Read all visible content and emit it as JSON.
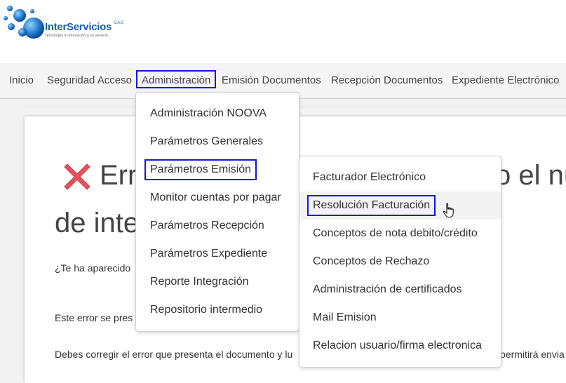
{
  "logo": {
    "name": "InterServicios",
    "suffix": "S.A.S",
    "tagline": "Tecnología e innovación a su servicio"
  },
  "nav": {
    "items": [
      {
        "label": "Inicio"
      },
      {
        "label": "Seguridad Acceso"
      },
      {
        "label": "Administración"
      },
      {
        "label": "Emisión Documentos"
      },
      {
        "label": "Recepción Documentos"
      },
      {
        "label": "Expediente Electrónico"
      }
    ],
    "active": "Administración"
  },
  "admin_menu": {
    "items": [
      {
        "label": "Administración NOOVA"
      },
      {
        "label": "Parámetros Generales"
      },
      {
        "label": "Parámetros Emisión"
      },
      {
        "label": "Monitor cuentas por pagar"
      },
      {
        "label": "Parámetros Recepción"
      },
      {
        "label": "Parámetros Expediente"
      },
      {
        "label": "Reporte Integración"
      },
      {
        "label": "Repositorio intermedio"
      }
    ],
    "highlighted": "Parámetros Emisión"
  },
  "emision_submenu": {
    "items": [
      {
        "label": "Facturador Electrónico"
      },
      {
        "label": "Resolución Facturación"
      },
      {
        "label": "Conceptos de nota debito/crédito"
      },
      {
        "label": "Conceptos de Rechazo"
      },
      {
        "label": "Administración de certificados"
      },
      {
        "label": "Mail Emision"
      },
      {
        "label": "Relacion usuario/firma electronica"
      }
    ],
    "highlighted": "Resolución Facturación"
  },
  "article": {
    "title_line1_left": "Err",
    "title_line1_right": "o el nú",
    "title_line2": "de inte",
    "para1": "¿Te ha aparecido",
    "para2": "Este error se pres",
    "para3_left": "Debes corregir el error que presenta el documento y lu",
    "para3_right": "permitirá envia"
  },
  "colors": {
    "highlight_border": "#1515e0",
    "error_icon": "#e8505b",
    "logo_blue": "#1d5fae"
  }
}
